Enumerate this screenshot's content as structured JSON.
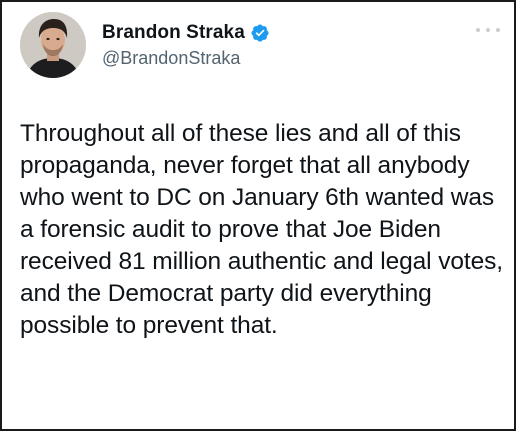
{
  "tweet": {
    "author": {
      "display_name": "Brandon Straka",
      "handle": "@BrandonStraka",
      "verified": true
    },
    "text": "Throughout all of these lies and all of this propaganda, never forget that all anybody who went to DC on January 6th wanted was a forensic audit to prove that Joe Biden received 81 million authentic and legal votes, and the Democrat party did everything possible to prevent that.",
    "icons": {
      "verified": "verified-badge-icon",
      "more": "more-options-icon"
    },
    "colors": {
      "text": "#0f1419",
      "handle": "#536471",
      "verified": "#1d9bf0",
      "border": "#1a1a1a"
    }
  }
}
